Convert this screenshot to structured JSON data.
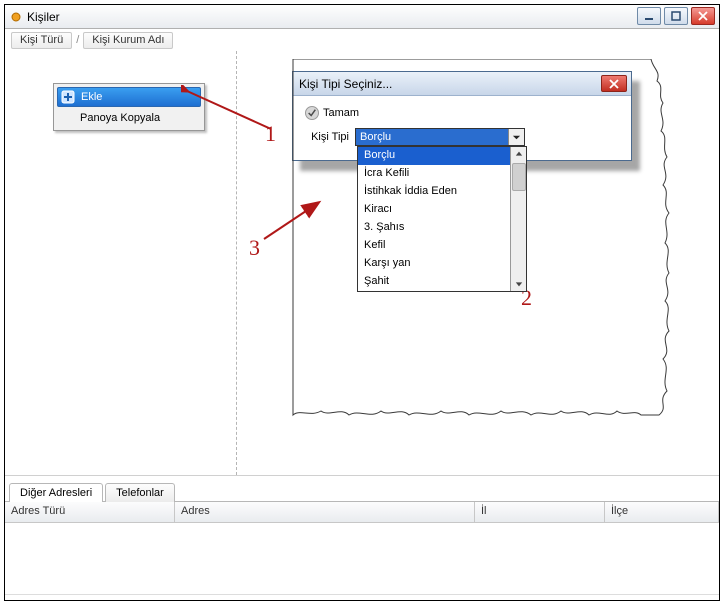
{
  "window": {
    "title": "Kişiler",
    "minimize": "min",
    "maximize": "max",
    "close": "x"
  },
  "breadcrumb": {
    "items": [
      "Kişi Türü",
      "Kişi Kurum Adı"
    ]
  },
  "context_menu": {
    "items": [
      {
        "label": "Ekle",
        "selected": true
      },
      {
        "label": "Panoya Kopyala",
        "selected": false
      }
    ]
  },
  "dialog": {
    "title": "Kişi Tipi Seçiniz...",
    "ok_label": "Tamam",
    "combo_label": "Kişi Tipi",
    "combo_value": "Borçlu",
    "options": [
      "Borçlu",
      "İcra Kefili",
      "İstihkak İddia Eden",
      "Kiracı",
      "3. Şahıs",
      "Kefil",
      "Karşı yan",
      "Şahit"
    ],
    "selected_option": "Borçlu"
  },
  "annotations": {
    "a1": "1",
    "a2": "2",
    "a3": "3"
  },
  "bottom": {
    "tabs": [
      "Diğer Adresleri",
      "Telefonlar"
    ],
    "active_tab": 0,
    "columns": [
      "Adres Türü",
      "Adres",
      "İl",
      "İlçe"
    ]
  }
}
